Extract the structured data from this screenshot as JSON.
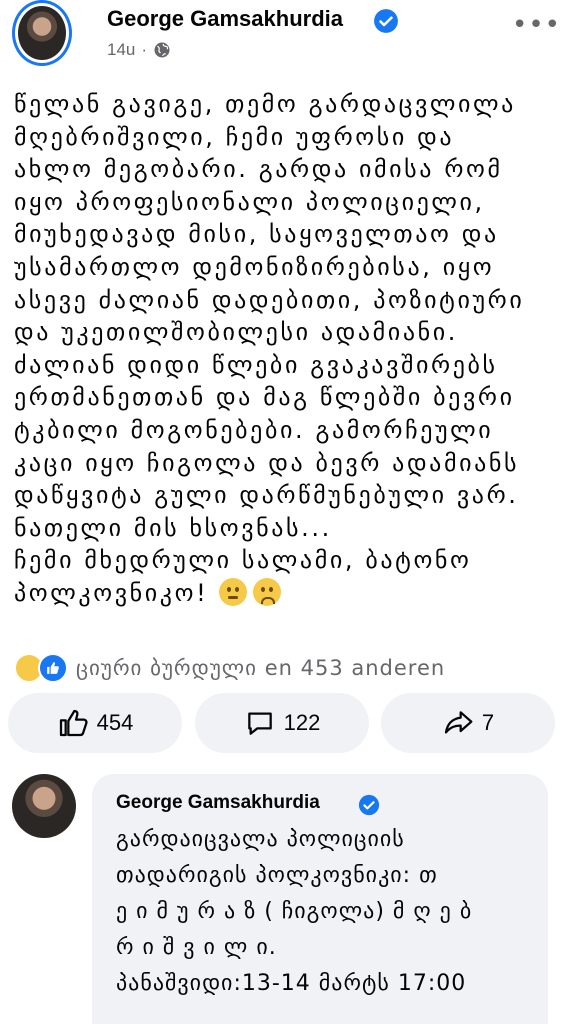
{
  "post": {
    "author": "George Gamsakhurdia",
    "time": "14u",
    "dot": "·",
    "more": "•••",
    "text_lines": [
      "წელან გავიგე, თემო გარდაცვლილა",
      "მღებრიშვილი, ჩემი უფროსი და",
      "ახლო მეგობარი. გარდა იმისა რომ",
      "იყო პროფესიონალი პოლიციელი,",
      "მიუხედავად მისი, საყოველთაო და",
      "უსამართლო დემონიზირებისა, იყო",
      "ასევე ძალიან დადებითი, პოზიტიური",
      "და უკეთილშობილესი ადამიანი.",
      "ძალიან დიდი წლები გვაკავშირებს",
      "ერთმანეთთან და მაგ წლებში ბევრი",
      "ტკბილი მოგონებები. გამორჩეული",
      "კაცი იყო ჩიგოლა და ბევრ ადამიანს",
      "დაწყვიტა გული დარწმუნებული ვარ.",
      "ნათელი მის ხსოვნას...",
      "ჩემი მხედრული სალამი, ბატონო",
      "პოლკოვნიკო!"
    ],
    "reactions_text": "ციური ბურდული en 453 anderen",
    "likes": "454",
    "comments": "122",
    "shares": "7"
  },
  "comment": {
    "author": "George Gamsakhurdia",
    "text_lines": [
      "გარდაიცვალა პოლიციის",
      "თადარიგის პოლკოვნიკი: თ",
      "ე ი მ უ რ ა ზ ( ჩიგოლა) მ ღ ე ბ",
      "რ ი შ ვ ი ლ ი.",
      "პანაშვიდი:13-14 მარტს 17:00"
    ]
  },
  "colors": {
    "accent": "#1877f2",
    "muted": "#65676b",
    "pill_bg": "#f0f2f5"
  },
  "icons": [
    "verified-badge-icon",
    "globe-icon",
    "more-icon",
    "like-icon",
    "comment-icon",
    "share-icon"
  ]
}
